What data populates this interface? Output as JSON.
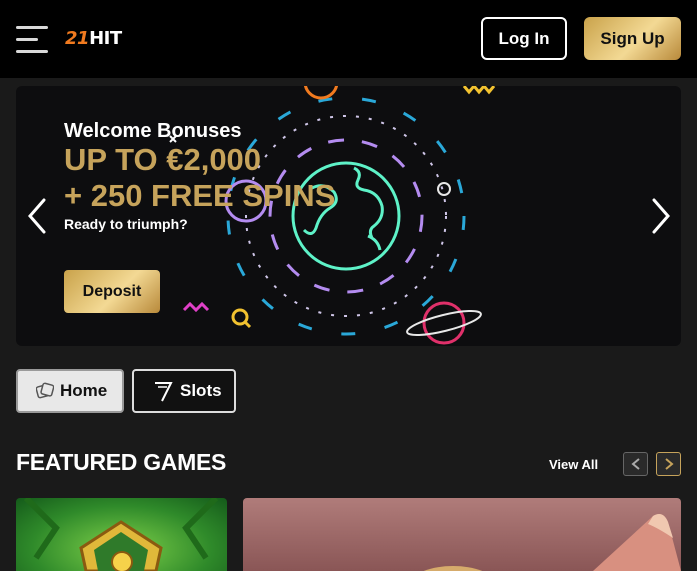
{
  "header": {
    "logo_number": "21",
    "logo_text": "HIT",
    "login_label": "Log In",
    "signup_label": "Sign Up"
  },
  "banner": {
    "welcome": "Welcome Bonuses",
    "headline_line1": "UP TO €2,000",
    "headline_line2": "+ 250 FREE SPINS",
    "tagline": "Ready to triumph?",
    "deposit_label": "Deposit"
  },
  "tabs": [
    {
      "label": "Home",
      "icon": "dice-icon",
      "active": true
    },
    {
      "label": "Slots",
      "icon": "seven-icon",
      "active": false
    }
  ],
  "featured": {
    "title": "FEATURED GAMES",
    "view_all": "View All"
  },
  "colors": {
    "gold": "#c6a35b",
    "accent_orange": "#f07a1f",
    "background": "#1a1a1a"
  }
}
